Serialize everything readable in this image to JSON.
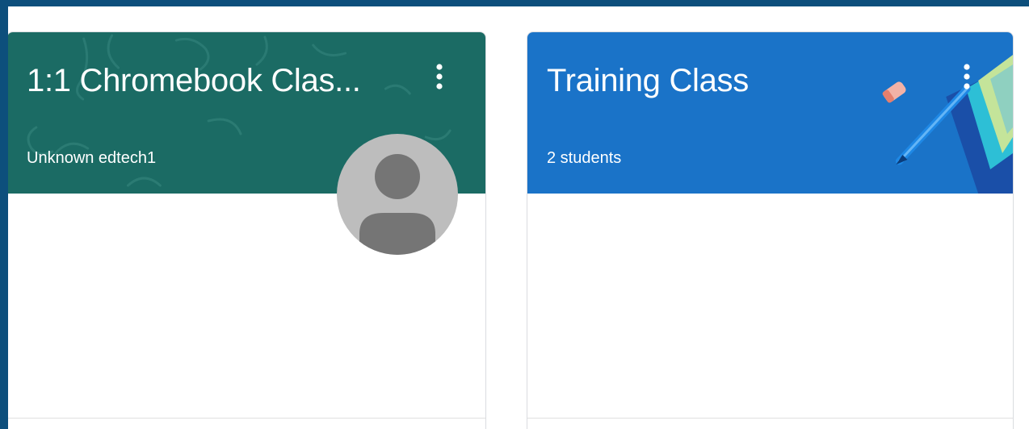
{
  "classes": [
    {
      "title": "1:1 Chromebook Clas...",
      "subtitle": "Unknown edtech1",
      "theme_color": "#1b6b64",
      "has_avatar": true,
      "menu_icon": "more-vert-icon",
      "avatar_icon": "person-icon"
    },
    {
      "title": "Training Class",
      "subtitle": "2 students",
      "theme_color": "#1a73c8",
      "has_avatar": false,
      "menu_icon": "more-vert-icon",
      "header_art": "pencil-and-books-illustration"
    }
  ],
  "colors": {
    "page_frame": "#0d4f7c",
    "card_border": "#dadce0",
    "avatar_bg": "#bdbdbd",
    "avatar_figure": "#757575"
  }
}
